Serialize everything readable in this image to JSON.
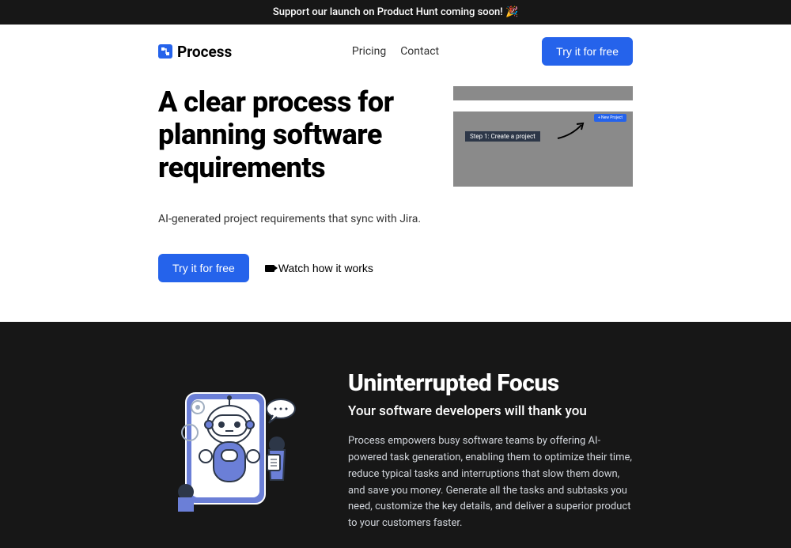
{
  "banner": {
    "text": "Support our launch on Product Hunt coming soon! 🎉"
  },
  "header": {
    "logo": "Process",
    "nav": {
      "pricing": "Pricing",
      "contact": "Contact"
    },
    "cta": "Try it for free"
  },
  "hero": {
    "title": "A clear process for planning software requirements",
    "subtitle": "AI-generated project requirements that sync with Jira.",
    "cta_primary": "Try it for free",
    "cta_secondary": "Watch how it works",
    "demo": {
      "button": "+ New Project",
      "step": "Step 1: Create a project"
    }
  },
  "focus": {
    "title": "Uninterrupted Focus",
    "subtitle": "Your software developers will thank you",
    "text": "Process empowers busy software teams by offering AI-powered task generation, enabling them to optimize their time, reduce typical tasks and interruptions that slow them down, and save you money. Generate all the tasks and subtasks you need, customize the key details, and deliver a superior product to your customers faster."
  }
}
